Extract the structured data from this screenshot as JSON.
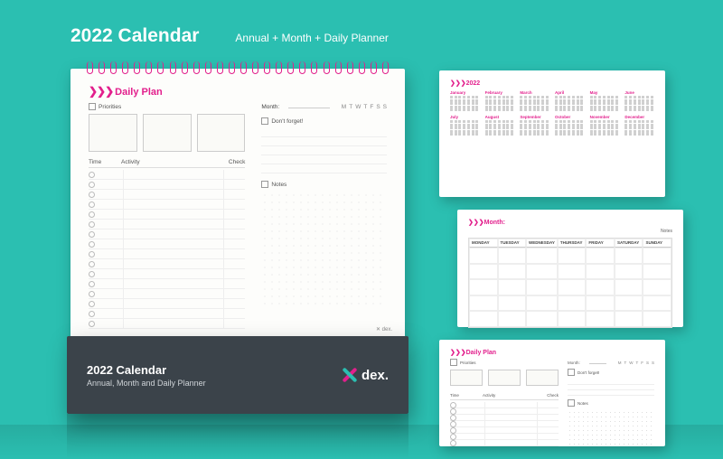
{
  "header": {
    "title": "2022 Calendar",
    "subtitle": "Annual + Month + Daily Planner"
  },
  "page": {
    "title": "Daily Plan",
    "priorities_label": "Priorities",
    "time_label": "Time",
    "activity_label": "Activity",
    "check_label": "Check",
    "month_label": "Month:",
    "days": [
      "M",
      "T",
      "W",
      "T",
      "F",
      "S",
      "S"
    ],
    "dont_forget_label": "Don't forget!",
    "notes_label": "Notes",
    "brand_tag": "✕ dex."
  },
  "base": {
    "line1": "2022 Calendar",
    "line2": "Annual, Month and Daily Planner",
    "logo_text": "dex."
  },
  "thumb_annual": {
    "year": "2022",
    "months": [
      "January",
      "February",
      "March",
      "April",
      "May",
      "June",
      "July",
      "August",
      "September",
      "October",
      "November",
      "December"
    ]
  },
  "thumb_month": {
    "title": "Month:",
    "notes": "Notes",
    "weekdays": [
      "MONDAY",
      "TUESDAY",
      "WEDNESDAY",
      "THURSDAY",
      "FRIDAY",
      "SATURDAY",
      "SUNDAY"
    ]
  }
}
